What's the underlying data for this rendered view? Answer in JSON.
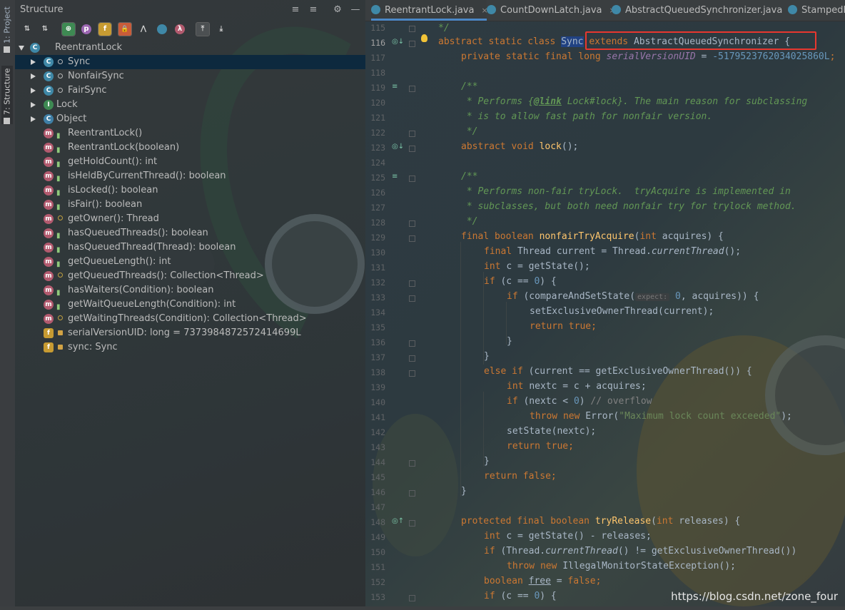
{
  "tool_strip": {
    "project_label": "1: Project",
    "structure_label": "7: Structure"
  },
  "structure": {
    "title": "Structure",
    "toolbar": {
      "sort_visibility": "⇅",
      "sort_alpha": "⇅",
      "show_inherited": "⊕",
      "show_properties": "p",
      "show_fields": "f",
      "show_nonpublic": "🔒",
      "show_anonymous": "⋀",
      "show_lambdas": "λ",
      "autoscroll_to": "⤒",
      "autoscroll_from": "⤓"
    },
    "tree": [
      {
        "label": "ReentrantLock",
        "icon": "class-icon",
        "indent": 0,
        "expanded": true
      },
      {
        "label": "Sync",
        "icon": "abstract-class-icon",
        "indent": 1,
        "collapsed": true,
        "selected": true
      },
      {
        "label": "NonfairSync",
        "icon": "class-icon",
        "indent": 1,
        "collapsed": true
      },
      {
        "label": "FairSync",
        "icon": "class-icon",
        "indent": 1,
        "collapsed": true
      },
      {
        "label": "Lock",
        "icon": "interface-icon",
        "indent": 1,
        "collapsed": true
      },
      {
        "label": "Object",
        "icon": "object-class-icon",
        "indent": 1,
        "collapsed": true
      },
      {
        "label": "ReentrantLock()",
        "icon": "method-icon",
        "indent": 2
      },
      {
        "label": "ReentrantLock(boolean)",
        "icon": "method-icon",
        "indent": 2
      },
      {
        "label": "getHoldCount(): int",
        "icon": "method-icon",
        "indent": 2
      },
      {
        "label": "isHeldByCurrentThread(): boolean",
        "icon": "method-icon",
        "indent": 2
      },
      {
        "label": "isLocked(): boolean",
        "icon": "method-icon",
        "indent": 2
      },
      {
        "label": "isFair(): boolean",
        "icon": "method-icon",
        "indent": 2
      },
      {
        "label": "getOwner(): Thread",
        "icon": "method-icon",
        "indent": 2
      },
      {
        "label": "hasQueuedThreads(): boolean",
        "icon": "method-icon",
        "indent": 2
      },
      {
        "label": "hasQueuedThread(Thread): boolean",
        "icon": "method-icon",
        "indent": 2
      },
      {
        "label": "getQueueLength(): int",
        "icon": "method-icon",
        "indent": 2
      },
      {
        "label": "getQueuedThreads(): Collection<Thread>",
        "icon": "method-icon",
        "indent": 2
      },
      {
        "label": "hasWaiters(Condition): boolean",
        "icon": "method-icon",
        "indent": 2
      },
      {
        "label": "getWaitQueueLength(Condition): int",
        "icon": "method-icon",
        "indent": 2
      },
      {
        "label": "getWaitingThreads(Condition): Collection<Thread>",
        "icon": "method-icon",
        "indent": 2
      },
      {
        "label": "serialVersionUID: long = 7373984872572414699L",
        "icon": "field-icon",
        "indent": 2
      },
      {
        "label": "sync: Sync",
        "icon": "field-icon",
        "indent": 2
      }
    ]
  },
  "editor": {
    "tabs": [
      {
        "label": "ReentrantLock.java",
        "active": true
      },
      {
        "label": "CountDownLatch.java"
      },
      {
        "label": "AbstractQueuedSynchronizer.java"
      },
      {
        "label": "StampedL"
      }
    ],
    "tab_close": "×",
    "line_numbers": [
      "115",
      "116",
      "117",
      "118",
      "119",
      "120",
      "121",
      "122",
      "123",
      "124",
      "125",
      "126",
      "127",
      "128",
      "129",
      "130",
      "131",
      "132",
      "133",
      "134",
      "135",
      "136",
      "137",
      "138",
      "139",
      "140",
      "141",
      "142",
      "143",
      "144",
      "145",
      "146",
      "147",
      "148",
      "149",
      "150",
      "151",
      "152",
      "153"
    ],
    "code": {
      "l115_comment": "*/",
      "l116_kw": "abstract static class ",
      "l116_name": "Sync",
      "l116_ext": " extends ",
      "l116_super": "AbstractQueuedSynchronizer {",
      "l117_kw": "private static final long ",
      "l117_field": "serialVersionUID",
      "l117_eq": " = ",
      "l117_num": "-5179523762034025860L",
      "l117_semi": ";",
      "l119": "/**",
      "l120_a": " * Performs {",
      "l120_link": "@link",
      "l120_b": " Lock#lock}. The main reason for subclassing",
      "l121": " * is to allow fast path for nonfair version.",
      "l122": " */",
      "l123_kw": "abstract void ",
      "l123_fn": "lock",
      "l123_rest": "();",
      "l125": "/**",
      "l126": " * Performs non-fair tryLock.  tryAcquire is implemented in",
      "l127": " * subclasses, but both need nonfair try for trylock method.",
      "l128": " */",
      "l129_kw": "final boolean ",
      "l129_fn": "nonfairTryAcquire",
      "l129_p": "(",
      "l129_kw2": "int ",
      "l129_rest": "acquires) {",
      "l130_kw": "final ",
      "l130_a": "Thread current = Thread.",
      "l130_it": "currentThread",
      "l130_b": "();",
      "l131_kw": "int ",
      "l131_rest": "c = getState();",
      "l132_kw": "if ",
      "l132_a": "(c == ",
      "l132_num": "0",
      "l132_b": ") {",
      "l133_kw": "if ",
      "l133_a": "(compareAndSetState(",
      "l133_hint": "expect:",
      "l133_num": " 0",
      "l133_b": ", acquires)) {",
      "l134": "setExclusiveOwnerThread(current);",
      "l135_kw": "return true",
      "l135_b": ";",
      "l136": "}",
      "l137": "}",
      "l138_kw": "else if ",
      "l138_rest": "(current == getExclusiveOwnerThread()) {",
      "l139_kw": "int ",
      "l139_rest": "nextc = c + acquires;",
      "l140_kw": "if ",
      "l140_a": "(nextc < ",
      "l140_num": "0",
      "l140_b": ") ",
      "l140_cm": "// overflow",
      "l141_kw": "throw new ",
      "l141_a": "Error(",
      "l141_str": "\"Maximum lock count exceeded\"",
      "l141_b": ");",
      "l142": "setState(nextc);",
      "l143_kw": "return true",
      "l143_b": ";",
      "l144": "}",
      "l145_kw": "return false",
      "l145_b": ";",
      "l146": "}",
      "l148_kw": "protected final boolean ",
      "l148_fn": "tryRelease",
      "l148_p": "(",
      "l148_kw2": "int ",
      "l148_rest": "releases) {",
      "l149_kw": "int ",
      "l149_rest": "c = getState() - releases;",
      "l150_kw": "if ",
      "l150_a": "(Thread.",
      "l150_it": "currentThread",
      "l150_b": "() != getExclusiveOwnerThread())",
      "l151_kw": "throw new ",
      "l151_rest": "IllegalMonitorStateException();",
      "l152_kw": "boolean ",
      "l152_ul": "free",
      "l152_a": " = ",
      "l152_kw2": "false",
      "l152_b": ";",
      "l153_kw": "if ",
      "l153_a": "(c == ",
      "l153_num": "0",
      "l153_b": ") {"
    }
  },
  "watermark": "https://blog.csdn.net/zone_four",
  "colors": {
    "highlight_box": "#e8372f",
    "keyword": "#cc7832",
    "comment": "#629755",
    "number": "#6897bb",
    "method": "#ffc66d",
    "field": "#9876aa"
  }
}
